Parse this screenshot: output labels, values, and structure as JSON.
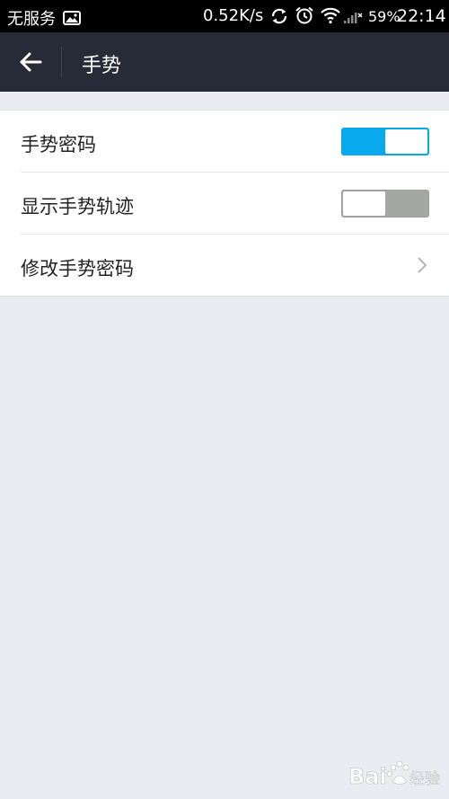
{
  "status_bar": {
    "carrier": "无服务",
    "speed": "0.52K/s",
    "battery": "59%",
    "time": "22:14",
    "icons": [
      "image-icon",
      "sync-icon",
      "alarm-icon",
      "wifi-icon",
      "signal-icon"
    ]
  },
  "header": {
    "title": "手势",
    "back_icon": "arrow-left-icon"
  },
  "settings": {
    "items": [
      {
        "label": "手势密码",
        "control": "toggle",
        "checked": true
      },
      {
        "label": "显示手势轨迹",
        "control": "toggle",
        "checked": false
      },
      {
        "label": "修改手势密码",
        "control": "chevron",
        "icon": "chevron-right-icon"
      }
    ]
  },
  "watermark": {
    "text": "Baidu经验"
  },
  "colors": {
    "status_bar_bg": "#000000",
    "action_bar_bg": "#272b38",
    "page_bg": "#ebecf1",
    "toggle_on": "#0aa8ec",
    "toggle_off": "#a5a7a4"
  }
}
